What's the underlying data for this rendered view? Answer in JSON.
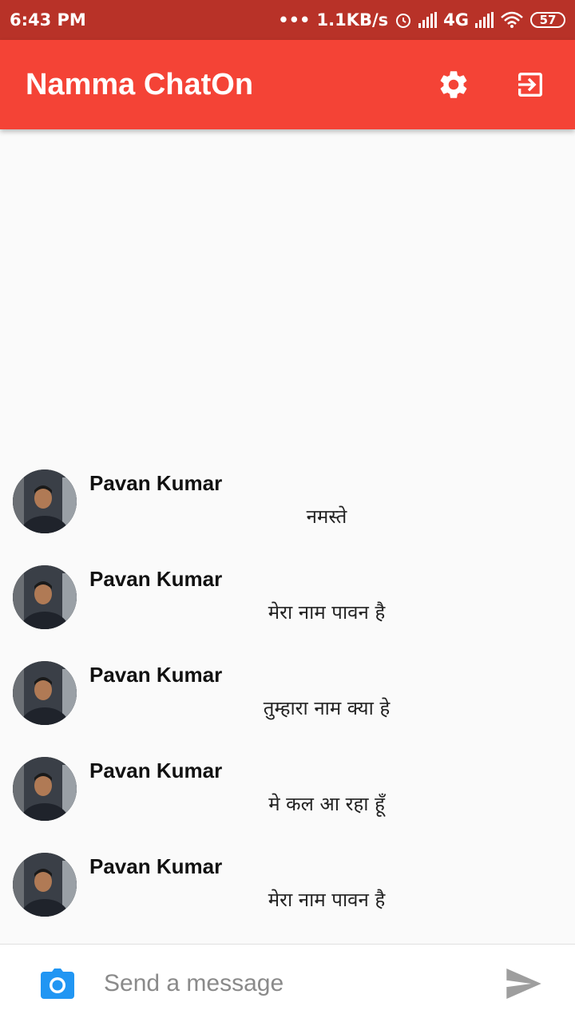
{
  "status_bar": {
    "time": "6:43 PM",
    "dots": "•••",
    "speed": "1.1KB/s",
    "network": "4G",
    "battery": "57",
    "icons": [
      "alarm-icon",
      "signal-icon",
      "signal-icon",
      "wifi-icon",
      "battery-icon"
    ]
  },
  "app_bar": {
    "title": "Namma ChatOn",
    "icons": [
      "gear-icon",
      "exit-icon"
    ]
  },
  "messages": [
    {
      "sender": "Pavan Kumar",
      "text": "नमस्ते"
    },
    {
      "sender": "Pavan Kumar",
      "text": "मेरा नाम पावन है"
    },
    {
      "sender": "Pavan Kumar",
      "text": "तुम्हारा नाम क्या हे"
    },
    {
      "sender": "Pavan Kumar",
      "text": "मे कल आ रहा हूँ"
    },
    {
      "sender": "Pavan Kumar",
      "text": "मेरा नाम पावन है"
    }
  ],
  "composer": {
    "placeholder": "Send a message",
    "value": "",
    "icons": [
      "camera-icon",
      "send-icon"
    ]
  },
  "colors": {
    "app_bar": "#f44336",
    "status_bar": "#b83228",
    "camera": "#2196f3",
    "send": "#9e9e9e"
  }
}
